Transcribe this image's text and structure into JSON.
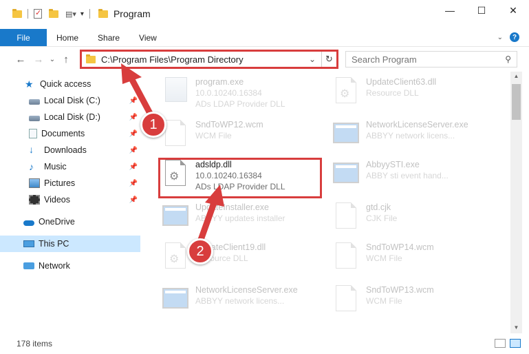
{
  "window": {
    "title": "Program",
    "controls": [
      "—",
      "☐",
      "✕"
    ]
  },
  "ribbon": {
    "tabs": [
      "File",
      "Home",
      "Share",
      "View"
    ]
  },
  "address": {
    "path": "C:\\Program Files\\Program Directory",
    "refresh_glyph": "↻"
  },
  "search": {
    "placeholder": "Search Program"
  },
  "sidebar": {
    "items": [
      {
        "label": "Quick access",
        "icon": "star-icon"
      },
      {
        "label": "Local Disk (C:)",
        "icon": "disk-icon",
        "pinned": true
      },
      {
        "label": "Local Disk (D:)",
        "icon": "disk-icon",
        "pinned": true
      },
      {
        "label": "Documents",
        "icon": "documents-icon",
        "pinned": true
      },
      {
        "label": "Downloads",
        "icon": "downloads-icon",
        "pinned": true
      },
      {
        "label": "Music",
        "icon": "music-icon",
        "pinned": true
      },
      {
        "label": "Pictures",
        "icon": "pictures-icon",
        "pinned": true
      },
      {
        "label": "Videos",
        "icon": "videos-icon",
        "pinned": true
      },
      {
        "label": "OneDrive",
        "icon": "onedrive-icon"
      },
      {
        "label": "This PC",
        "icon": "this-pc-icon",
        "selected": true
      },
      {
        "label": "Network",
        "icon": "network-icon"
      }
    ]
  },
  "files": [
    {
      "name": "program.exe",
      "line1": "10.0.10240.16384",
      "line2": "ADs LDAP Provider DLL",
      "icon": "exe-icon",
      "faded": true
    },
    {
      "name": "UpdateClient63.dll",
      "line1": "Resource DLL",
      "line2": "",
      "icon": "dll-icon",
      "faded": true
    },
    {
      "name": "SndToWP12.wcm",
      "line1": "WCM File",
      "line2": "",
      "icon": "document-icon",
      "faded": true
    },
    {
      "name": "NetworkLicenseServer.exe",
      "line1": "ABBYY network licens...",
      "line2": "",
      "icon": "app-icon",
      "faded": true
    },
    {
      "name": "adsldp.dll",
      "line1": "10.0.10240.16384",
      "line2": "ADs LDAP Provider DLL",
      "icon": "dll-icon",
      "faded": false
    },
    {
      "name": "AbbyySTI.exe",
      "line1": "ABBY sti event hand...",
      "line2": "",
      "icon": "app-icon",
      "faded": true
    },
    {
      "name": "UpdateInstaller.exe",
      "line1": "ABBYY updates installer",
      "line2": "",
      "icon": "app-icon",
      "faded": true
    },
    {
      "name": "gtd.cjk",
      "line1": "CJK File",
      "line2": "",
      "icon": "document-icon",
      "faded": true
    },
    {
      "name": "UpdateClient19.dll",
      "line1": "Resource DLL",
      "line2": "",
      "icon": "dll-icon",
      "faded": true
    },
    {
      "name": "SndToWP14.wcm",
      "line1": "WCM File",
      "line2": "",
      "icon": "document-icon",
      "faded": true
    },
    {
      "name": "NetworkLicenseServer.exe",
      "line1": "ABBYY network licens...",
      "line2": "",
      "icon": "app-icon",
      "faded": true
    },
    {
      "name": "SndToWP13.wcm",
      "line1": "WCM File",
      "line2": "",
      "icon": "document-icon",
      "faded": true
    }
  ],
  "status": {
    "item_count": "178 items"
  },
  "callouts": [
    "1",
    "2"
  ],
  "colors": {
    "accent": "#1979ca",
    "highlight": "#d83d3d",
    "selected_bg": "#cce8ff"
  }
}
